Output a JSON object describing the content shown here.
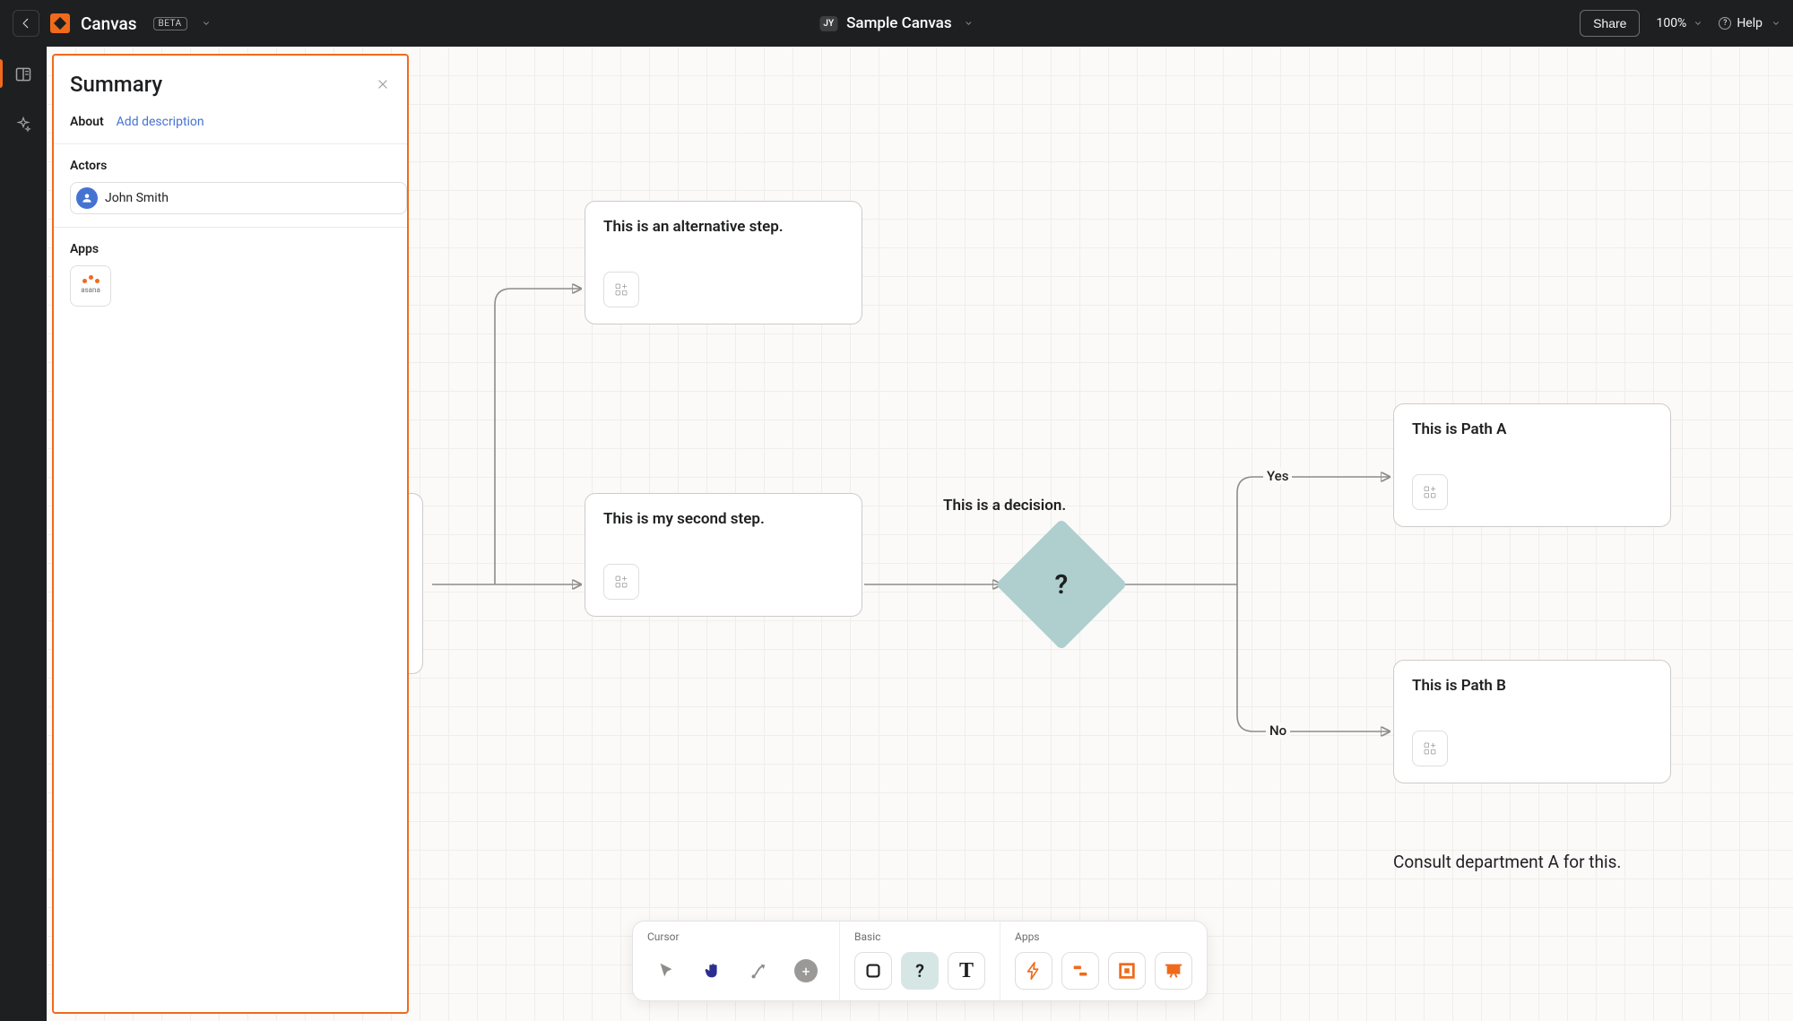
{
  "header": {
    "app_title": "Canvas",
    "beta_label": "BETA",
    "owner_initials": "JY",
    "document_title": "Sample Canvas",
    "share_label": "Share",
    "zoom_level": "100%",
    "help_label": "Help"
  },
  "summary": {
    "title": "Summary",
    "about_label": "About",
    "add_description_label": "Add description",
    "actors_heading": "Actors",
    "actor_name": "John Smith",
    "apps_heading": "Apps",
    "app_name": "asana"
  },
  "nodes": {
    "alt_step_text": "This is an alternative step.",
    "second_step_text": "This is my second step.",
    "decision_label": "This is a decision.",
    "decision_symbol": "?",
    "path_a_text": "This is Path A",
    "path_b_text": "This is Path B",
    "edge_yes": "Yes",
    "edge_no": "No",
    "free_text": "Consult department A for this."
  },
  "toolbar": {
    "cursor_heading": "Cursor",
    "basic_heading": "Basic",
    "apps_heading": "Apps",
    "decision_symbol": "?",
    "text_symbol": "T"
  }
}
